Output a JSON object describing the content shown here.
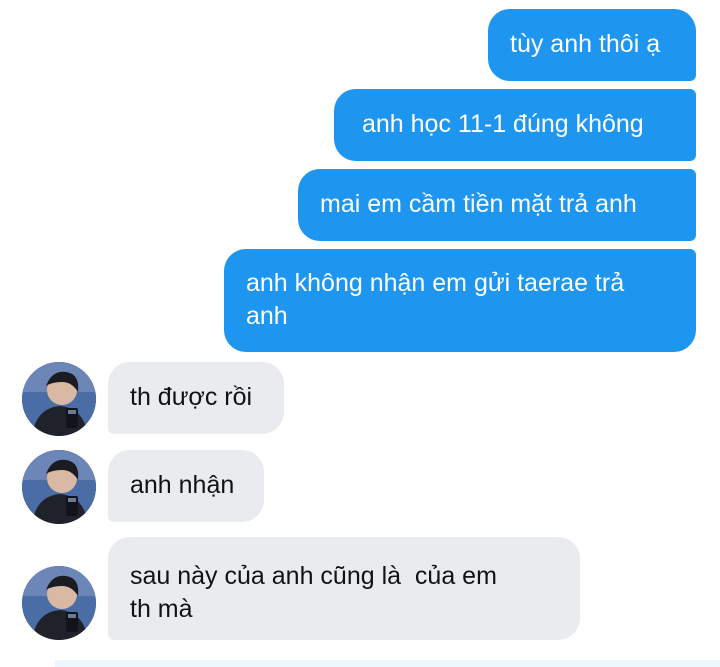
{
  "conversation": {
    "sent_messages": [
      "tùy anh thôi ạ",
      "anh học 11-1 đúng không",
      "mai em cầm tiền mặt trả anh",
      "anh không nhận em gửi taerae trả\nanh"
    ],
    "received_messages": [
      "th được rồi",
      "anh nhận",
      "sau này của anh cũng là  của em\nth mà"
    ]
  },
  "colors": {
    "sent_bubble": "#1e96f0",
    "received_bubble": "#e9ebee",
    "sent_text": "#ffffff",
    "received_text": "#101316"
  },
  "icons": {
    "contact_avatar": "profile-photo"
  }
}
